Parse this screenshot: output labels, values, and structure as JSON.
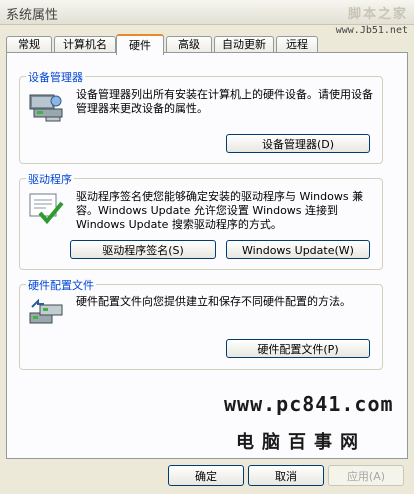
{
  "window": {
    "title": "系统属性",
    "watermark_top": "脚本之家",
    "watermark_url": "www.Jb51.net"
  },
  "tabs": [
    {
      "label": "常规"
    },
    {
      "label": "计算机名"
    },
    {
      "label": "硬件",
      "active": true
    },
    {
      "label": "高级"
    },
    {
      "label": "自动更新"
    },
    {
      "label": "远程"
    }
  ],
  "device_manager": {
    "title": "设备管理器",
    "description": "设备管理器列出所有安装在计算机上的硬件设备。请使用设备管理器来更改设备的属性。",
    "button": "设备管理器(D)"
  },
  "drivers": {
    "title": "驱动程序",
    "description": "驱动程序签名使您能够确定安装的驱动程序与 Windows 兼容。Windows Update 允许您设置 Windows 连接到 Windows Update 搜索驱动程序的方式。",
    "signing_button": "驱动程序签名(S)",
    "update_button": "Windows Update(W)"
  },
  "hardware_profiles": {
    "title": "硬件配置文件",
    "description": "硬件配置文件向您提供建立和保存不同硬件配置的方法。",
    "button": "硬件配置文件(P)"
  },
  "branding": {
    "url": "www.pc841.com",
    "name": "电脑百事网"
  },
  "footer": {
    "ok": "确定",
    "cancel": "取消",
    "apply": "应用(A)"
  },
  "colors": {
    "accent_tab": "#e68b2c",
    "group_title": "#0046d5",
    "button_border": "#003c74"
  },
  "icons": {
    "device_manager": "device-manager-icon",
    "drivers": "driver-signing-icon",
    "hardware_profiles": "hardware-profile-icon"
  }
}
